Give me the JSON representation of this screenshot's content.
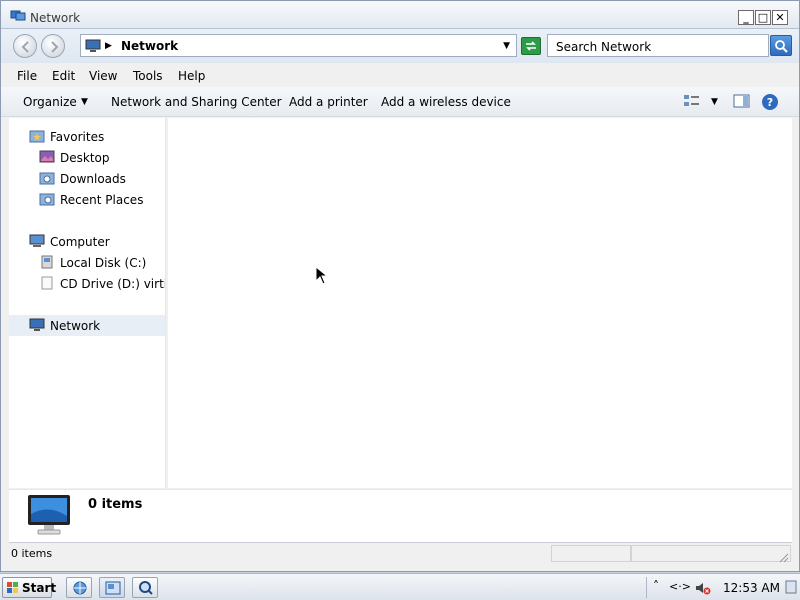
{
  "window": {
    "title": "Network",
    "controls": {
      "minimize": "_",
      "maximize": "□",
      "close": "✕"
    }
  },
  "address": {
    "location": "Network",
    "search_placeholder": "Search Network"
  },
  "menu": [
    "File",
    "Edit",
    "View",
    "Tools",
    "Help"
  ],
  "commands": {
    "organize": "Organize",
    "network_sharing": "Network and Sharing Center",
    "add_printer": "Add a printer",
    "add_wireless": "Add a wireless device"
  },
  "nav": {
    "favorites": "Favorites",
    "desktop": "Desktop",
    "downloads": "Downloads",
    "recent": "Recent Places",
    "computer": "Computer",
    "local_disk": "Local Disk (C:)",
    "cd_drive": "CD Drive (D:) virtio",
    "network": "Network"
  },
  "details": {
    "count": "0 items"
  },
  "status": {
    "count": "0 items"
  },
  "taskbar": {
    "start": "Start",
    "time": "12:53 AM"
  },
  "colors": {
    "accent": "#2c6bc0",
    "refresh": "#2e9b48",
    "selection": "#e8eef5"
  }
}
